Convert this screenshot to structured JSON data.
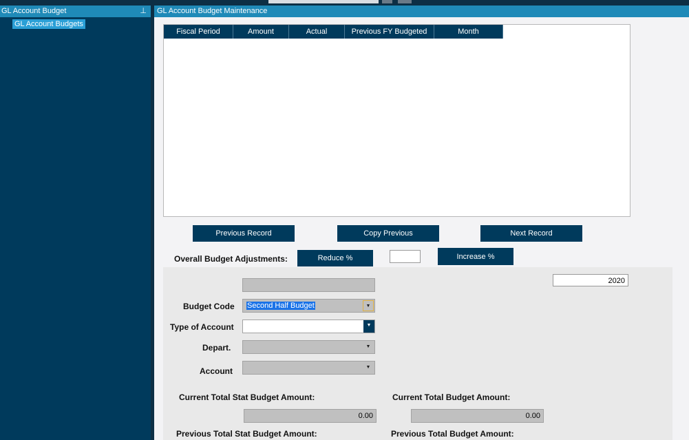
{
  "left_panel": {
    "title": "GL Account Budget",
    "pin_icon": "pin-icon",
    "items": [
      {
        "label": "GL Account Budgets"
      }
    ]
  },
  "main": {
    "title": "GL Account Budget Maintenance",
    "grid": {
      "columns": [
        "Fiscal Period",
        "Amount",
        "Actual",
        "Previous FY Budgeted",
        "Month"
      ],
      "rows": []
    },
    "buttons": {
      "previous": "Previous Record",
      "copy": "Copy Previous",
      "next": "Next Record",
      "reduce": "Reduce %",
      "increase": "Increase %"
    },
    "adjust_label": "Overall Budget Adjustments:",
    "adjust_value": "",
    "year": "2020",
    "form": {
      "budget_code_label": "Budget Code",
      "budget_code_value": "Second Half Budget",
      "type_label": "Type of Account",
      "type_value": "",
      "depart_label": "Depart.",
      "depart_value": "",
      "account_label": "Account",
      "account_value": ""
    },
    "totals": {
      "cur_stat_label": "Current Total Stat Budget Amount:",
      "cur_stat_value": "0.00",
      "cur_label": "Current Total Budget Amount:",
      "cur_value": "0.00",
      "prev_stat_label": "Previous Total Stat Budget Amount:",
      "prev_label": "Previous Total Budget Amount:"
    }
  }
}
